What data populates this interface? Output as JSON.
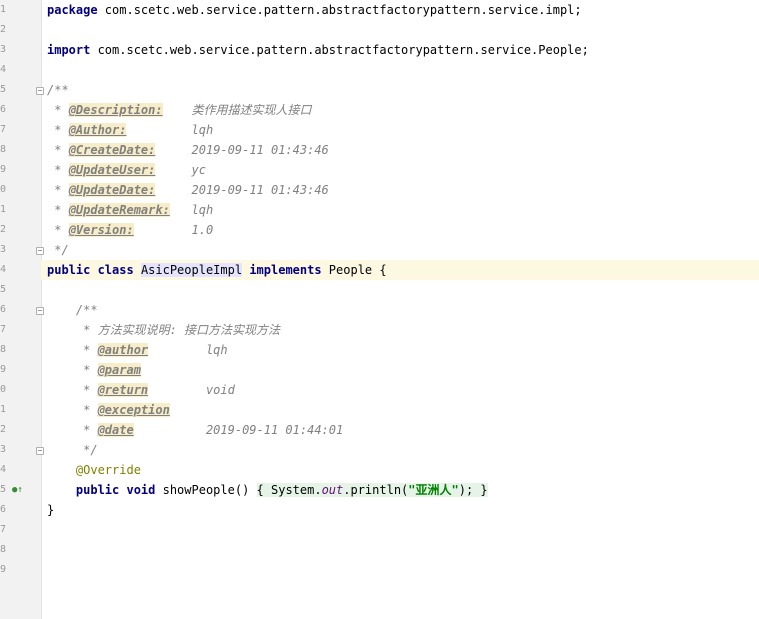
{
  "gutter": {
    "line_numbers": [
      "1",
      "2",
      "3",
      "4",
      "5",
      "6",
      "7",
      "8",
      "9",
      "0",
      "1",
      "2",
      "3",
      "4",
      "5",
      "6",
      "7",
      "8",
      "9",
      "0",
      "1",
      "2",
      "3",
      "4",
      "5",
      "6",
      "7",
      "8",
      "9"
    ]
  },
  "code": {
    "package_kw": "package",
    "package_name": " com.scetc.web.service.pattern.abstractfactorypattern.service.impl;",
    "import_kw": "import",
    "import_name": " com.scetc.web.service.pattern.abstractfactorypattern.service.People;",
    "doc_open": "/**",
    "doc_star": " * ",
    "doc_close": " */",
    "class_tags": [
      {
        "tag": "@Description:",
        "pad": "    ",
        "value": "类作用描述实现人接口"
      },
      {
        "tag": "@Author:",
        "pad": "         ",
        "value": "lqh"
      },
      {
        "tag": "@CreateDate:",
        "pad": "     ",
        "value": "2019-09-11 01:43:46"
      },
      {
        "tag": "@UpdateUser:",
        "pad": "     ",
        "value": "yc"
      },
      {
        "tag": "@UpdateDate:",
        "pad": "     ",
        "value": "2019-09-11 01:43:46"
      },
      {
        "tag": "@UpdateRemark:",
        "pad": "   ",
        "value": "lqh"
      },
      {
        "tag": "@Version:",
        "pad": "        ",
        "value": "1.0"
      }
    ],
    "public_class_kw": "public class",
    "class_name": "AsicPeopleImpl",
    "implements_kw": "implements",
    "interface_name": " People {",
    "method_doc_open": "    /**",
    "method_doc_desc": "     * 方法实现说明: 接口方法实现方法",
    "method_star": "     * ",
    "method_doc_close": "     */",
    "method_tags": [
      {
        "tag": "@author",
        "pad": "        ",
        "value": "lqh"
      },
      {
        "tag": "@param",
        "pad": "",
        "value": ""
      },
      {
        "tag": "@return",
        "pad": "        ",
        "value": "void"
      },
      {
        "tag": "@exception",
        "pad": "",
        "value": ""
      },
      {
        "tag": "@date",
        "pad": "          ",
        "value": "2019-09-11 01:44:01"
      }
    ],
    "override": "    @Override",
    "method_public_void": "    public void",
    "method_name": " showPeople() ",
    "method_body_open": "{",
    "method_body_system": " System.",
    "method_body_out": "out",
    "method_body_println": ".println(",
    "method_body_string": "\"亚洲人\"",
    "method_body_end": "); ",
    "method_body_close": "}",
    "class_close": "}"
  }
}
